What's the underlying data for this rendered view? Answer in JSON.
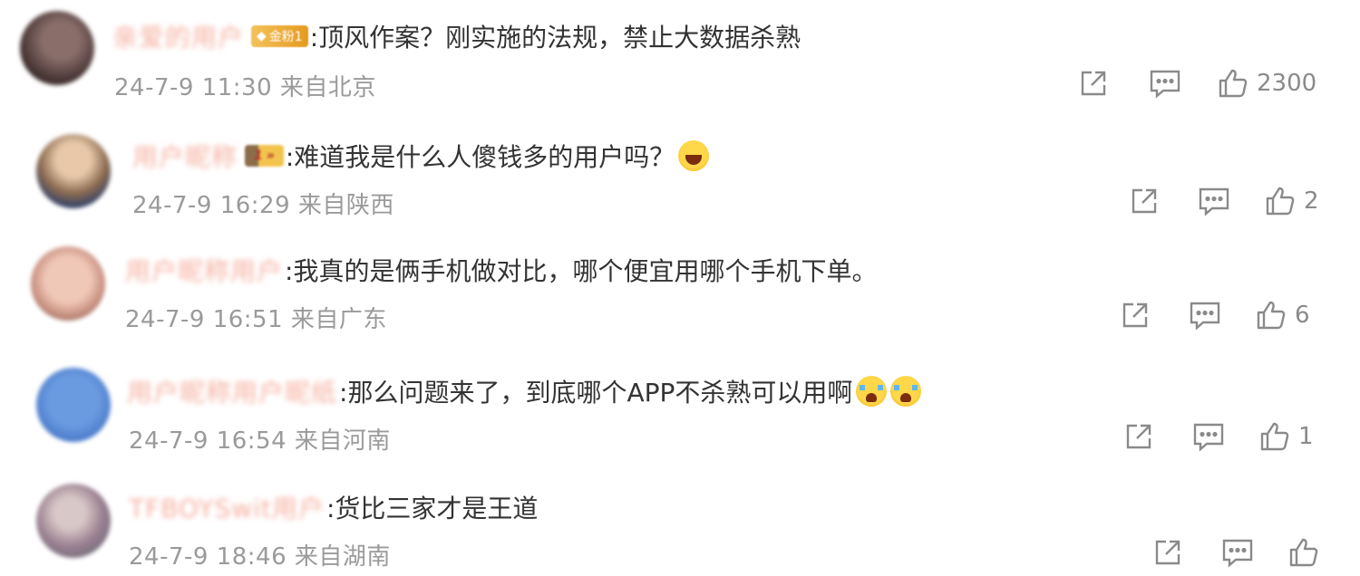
{
  "comments": [
    {
      "username": "亲爱的用户",
      "badge": "金粉1",
      "badge_type": "fan",
      "text": ":顶风作案？刚实施的法规，禁止大数据杀熟",
      "date": "24-7-9 11:30",
      "location": "来自北京",
      "likes": "2300",
      "avatar_color": "#5a4a48"
    },
    {
      "username": "用户昵称",
      "badge": "1",
      "badge_type": "level",
      "text": ":难道我是什么人傻钱多的用户吗？",
      "emoji": "laugh",
      "date": "24-7-9 16:29",
      "location": "来自陕西",
      "likes": "2",
      "avatar_color": "#b88a6a"
    },
    {
      "username": "用户昵称用户",
      "text": ":我真的是俩手机做对比，哪个便宜用哪个手机下单。",
      "date": "24-7-9 16:51",
      "location": "来自广东",
      "likes": "6",
      "avatar_color": "#d9a58e"
    },
    {
      "username": "用户昵称用户昵纸",
      "text": ":那么问题来了，到底哪个APP不杀熟可以用啊",
      "emoji": "cry-cry",
      "date": "24-7-9 16:54",
      "location": "来自河南",
      "likes": "1",
      "avatar_color": "#4a78c8"
    },
    {
      "username": "TFBOYSwit用户",
      "text": ":货比三家才是王道",
      "date": "24-7-9 18:46",
      "location": "来自湖南",
      "likes": "",
      "avatar_color": "#9a8a9a"
    }
  ],
  "icons": {
    "share": "share-icon",
    "comment": "comment-icon",
    "like": "thumbs-up-icon"
  }
}
